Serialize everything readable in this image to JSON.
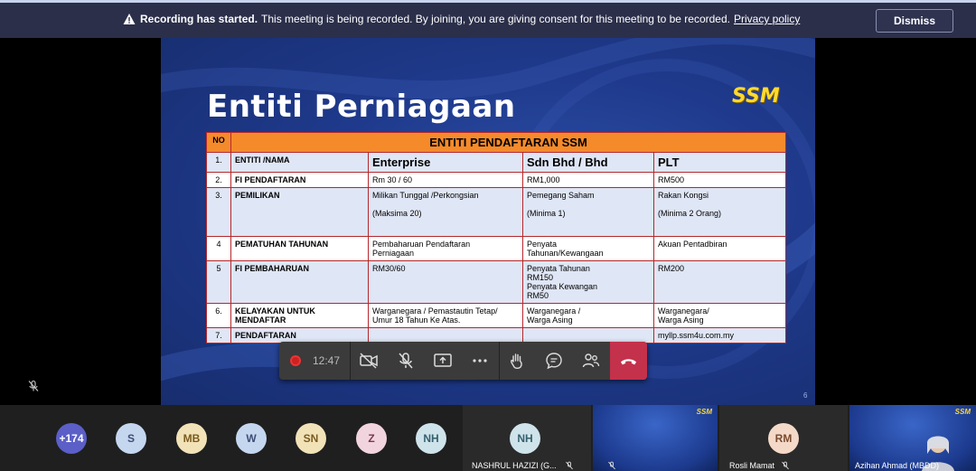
{
  "banner": {
    "title": "Recording has started.",
    "message": "This meeting is being recorded. By joining, you are giving consent for this meeting to be recorded.",
    "link": "Privacy policy",
    "dismiss": "Dismiss"
  },
  "slide": {
    "title": "Entiti Perniagaan",
    "logo": "SSM",
    "page": "6",
    "table": {
      "no_header": "NO",
      "main_header": "ENTITI PENDAFTARAN SSM",
      "rows": [
        {
          "no": "1.",
          "label": "ENTITI /NAMA",
          "c1": "Enterprise",
          "c2": "Sdn Bhd / Bhd",
          "c3": "PLT"
        },
        {
          "no": "2.",
          "label": "FI PENDAFTARAN",
          "c1": "Rm 30 / 60",
          "c2": "RM1,000",
          "c3": "RM500"
        },
        {
          "no": "3.",
          "label": "PEMILIKAN",
          "c1a": "Milikan Tunggal /Perkongsian",
          "c1b": "(Maksima 20)",
          "c2a": "Pemegang Saham",
          "c2b": "(Minima 1)",
          "c3a": "Rakan Kongsi",
          "c3b": "(Minima 2 Orang)"
        },
        {
          "no": "4",
          "label": "PEMATUHAN TAHUNAN",
          "c1a": "Pembaharuan Pendaftaran",
          "c1b": "Perniagaan",
          "c2a": "Penyata",
          "c2b": "Tahunan/Kewangaan",
          "c3": "Akuan Pentadbiran"
        },
        {
          "no": "5",
          "label": "FI PEMBAHARUAN",
          "c1": "RM30/60",
          "c2a": "Penyata Tahunan",
          "c2b": "RM150",
          "c2c": "Penyata Kewangan",
          "c2d": "RM50",
          "c3": "RM200"
        },
        {
          "no": "6.",
          "label_a": "KELAYAKAN UNTUK",
          "label_b": "MENDAFTAR",
          "c1a": "Warganegara / Pemastautin Tetap/",
          "c1b": "Umur 18 Tahun Ke Atas.",
          "c2a": "Warganegara /",
          "c2b": "Warga Asing",
          "c3a": "Warganegara/",
          "c3b": "Warga Asing"
        },
        {
          "no": "7.",
          "label": "PENDAFTARAN",
          "c3": "myllp.ssm4u.com.my"
        }
      ]
    }
  },
  "controls": {
    "timer": "12:47"
  },
  "participants": {
    "overflow": "+174",
    "avatars": [
      {
        "initials": "S",
        "bg": "#c5d6ef",
        "fg": "#3c4e74"
      },
      {
        "initials": "MB",
        "bg": "#f2e2b8",
        "fg": "#7a5b1e"
      },
      {
        "initials": "W",
        "bg": "#c5d6ef",
        "fg": "#3c4e74"
      },
      {
        "initials": "SN",
        "bg": "#f2e2b8",
        "fg": "#7a5b1e"
      },
      {
        "initials": "Z",
        "bg": "#f2d4de",
        "fg": "#7a3950"
      },
      {
        "initials": "NH",
        "bg": "#cfe3ea",
        "fg": "#35606e"
      }
    ],
    "tiles": [
      {
        "initials": "NH",
        "name": "NASHRUL HAZIZI (G..."
      },
      {
        "initials": "RM",
        "name": "Rosli Mamat"
      },
      {
        "name": "Azihan Ahmad (MBDD)"
      }
    ]
  },
  "colors": {
    "banner_bg": "#2b2f4a",
    "end_call": "#c4314b",
    "table_border": "#b4282d",
    "table_header": "#f58a2b"
  }
}
